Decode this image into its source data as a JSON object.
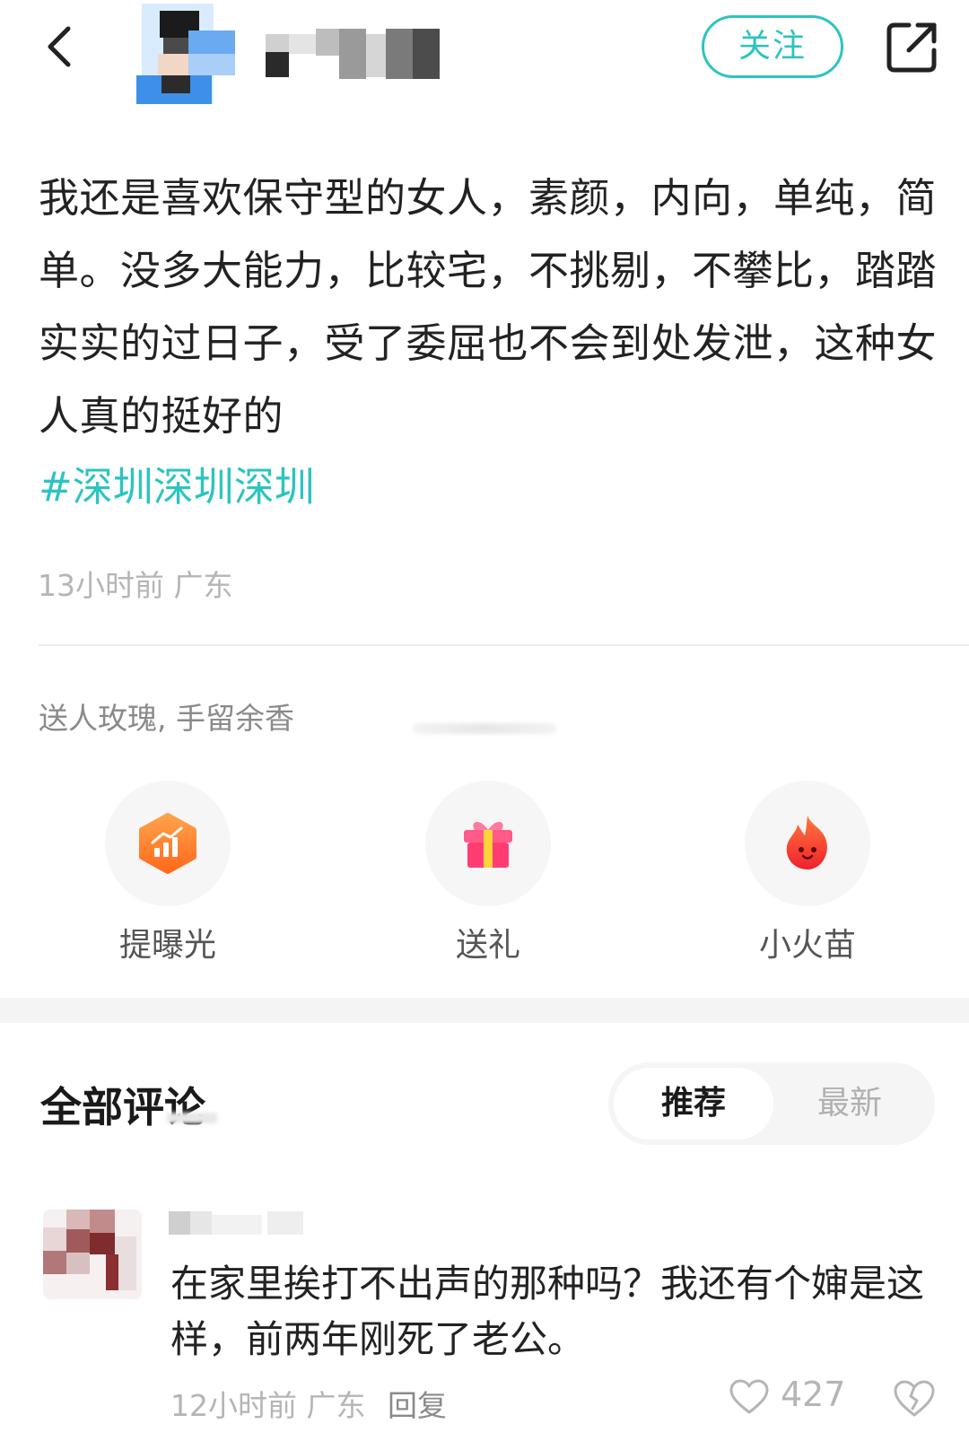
{
  "header": {
    "follow_label": "关注"
  },
  "post": {
    "text": "我还是喜欢保守型的女人，素颜，内向，单纯，简单。没多大能力，比较宅，不挑剔，不攀比，踏踏实实的过日子，受了委屈也不会到处发泄，这种女人真的挺好的",
    "hashtag": "#深圳深圳深圳",
    "time": "13小时前",
    "location": "广东"
  },
  "gifts": {
    "tip": "送人玫瑰, 手留余香",
    "actions": [
      {
        "label": "提曝光",
        "icon": "boost-icon"
      },
      {
        "label": "送礼",
        "icon": "gift-icon"
      },
      {
        "label": "小火苗",
        "icon": "flame-icon"
      }
    ]
  },
  "comments": {
    "title": "全部评论",
    "sort_options": [
      "推荐",
      "最新"
    ],
    "active_sort": "推荐",
    "items": [
      {
        "text": "在家里挨打不出声的那种吗？我还有个婶是这样，前两年刚死了老公。",
        "time": "12小时前",
        "location": "广东",
        "reply_label": "回复",
        "likes": "427"
      }
    ]
  },
  "colors": {
    "accent": "#2cc4c0",
    "meta_gray": "#b5b5b5"
  }
}
